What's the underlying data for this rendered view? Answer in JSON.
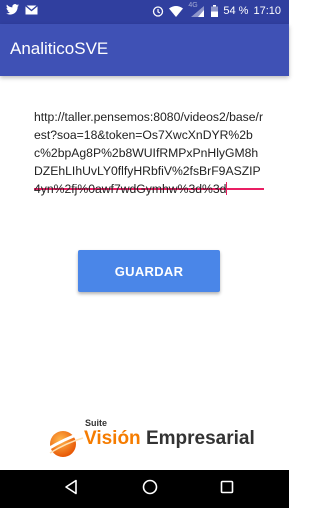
{
  "status_bar": {
    "network_label": "4G",
    "battery": "54 %",
    "time": "17:10"
  },
  "app_bar": {
    "title": "AnaliticoSVE"
  },
  "url_field": {
    "value": "http://taller.pensemos:8080/videos2/base/rest?soa=18&token=Os7XwcXnDYR%2bc%2bpAg8P%2b8WUIfRMPxPnHlyGM8hDZEhLIhUvLY0flfyHRbfiV%2fsBrF9ASZIP4yn%2fj%0awf7wdGymhw%3d%3d",
    "underline_color": "#e91e63"
  },
  "save_button": {
    "label": "GUARDAR",
    "color": "#4a86e8"
  },
  "logo": {
    "suite": "Suite",
    "vision": "Visión",
    "empresarial": "Empresarial",
    "vision_color": "#f57c00",
    "icon": "globe-swoosh-icon"
  },
  "nav_bar": {
    "back_icon": "back-triangle-icon",
    "home_icon": "home-circle-icon",
    "recents_icon": "recents-square-icon"
  },
  "colors": {
    "status_bar": "#303f9f",
    "app_bar": "#3f51b5"
  }
}
